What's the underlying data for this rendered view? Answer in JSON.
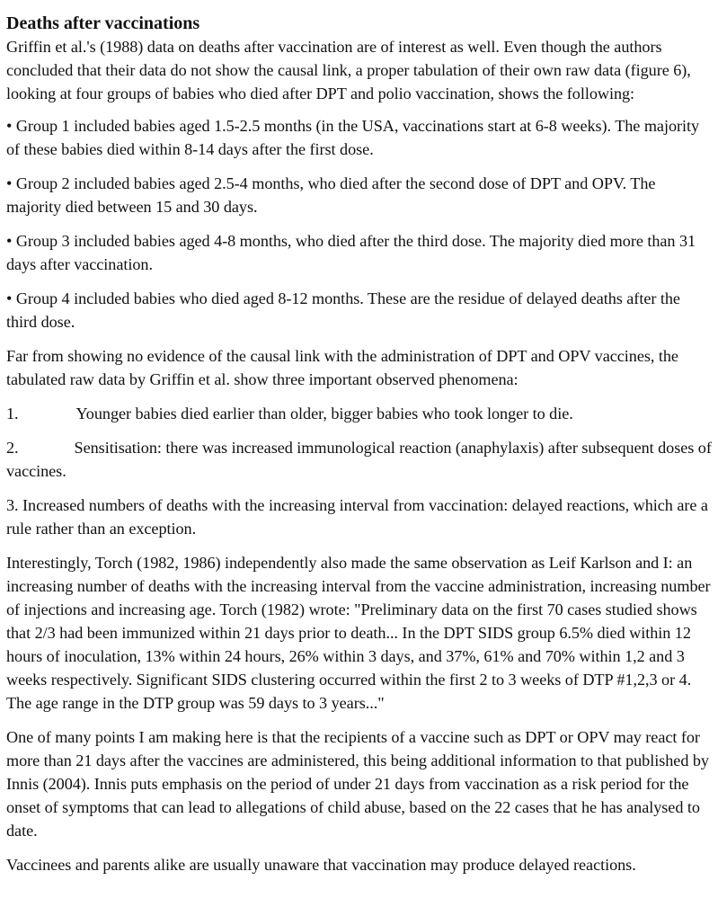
{
  "document": {
    "heading": "Deaths after vaccinations",
    "intro": "Griffin et al.'s (1988) data on deaths after vaccination are of interest as well. Even though the authors concluded that their data do not show the causal link, a proper tabulation of their own raw data (figure 6), looking at four groups of babies who died after DPT and polio vaccination, shows the following:",
    "groups": [
      "• Group 1 included babies aged 1.5-2.5 months (in the USA, vaccinations start at 6-8 weeks). The majority of these babies died within 8-14 days after the first dose.",
      "• Group 2 included babies aged 2.5-4 months, who died after the second dose of DPT and OPV. The majority died between 15 and 30 days.",
      "• Group 3 included babies aged 4-8 months, who died after the third dose. The majority died more than 31 days after vaccination.",
      "• Group 4 included babies who died aged 8-12 months.   These are the residue of delayed deaths after the third dose."
    ],
    "far_from": "Far from showing no evidence of the causal link with the administration of DPT and OPV vaccines, the tabulated raw data by Griffin et al. show three important observed phenomena:",
    "phenomena": [
      {
        "number": "1.",
        "text": "Younger babies died earlier than older, bigger babies who took longer to die."
      },
      {
        "number": "2.",
        "text": "Sensitisation:   there was increased immunological reaction (anaphylaxis) after subsequent doses of vaccines."
      },
      {
        "number": "",
        "text": "3. Increased numbers of deaths with the increasing interval from vaccination: delayed reactions, which are a rule rather than an exception."
      }
    ],
    "torch": "Interestingly, Torch (1982, 1986) independently also made the same observation as Leif Karlson and I: an increasing number of deaths with the increasing interval from the vaccine administration, increasing number of injections and increasing age. Torch (1982) wrote: \"Preliminary data on the first 70 cases studied shows that 2/3 had been immunized within 21 days prior to death... In the DPT SIDS group 6.5% died within 12 hours of inoculation, 13% within 24 hours, 26% within 3 days, and 37%, 61% and 70% within 1,2 and 3 weeks respectively. Significant SIDS clustering occurred within the first 2 to 3 weeks of DTP #1,2,3 or 4. The age range in the DTP group was 59 days to 3 years...\"",
    "one_of_many": "One of many points I am making here is that the recipients of a vaccine such as DPT or OPV may react for more than 21 days after the vaccines are administered, this being additional information to that published by Innis (2004). Innis puts emphasis on the period of under 21 days from vaccination as a risk period for the onset of symptoms that can lead to allegations of child abuse, based on the 22 cases that he has analysed to date.",
    "cut_off": "Vaccinees and parents alike are usually unaware that vaccination may produce delayed reactions."
  }
}
